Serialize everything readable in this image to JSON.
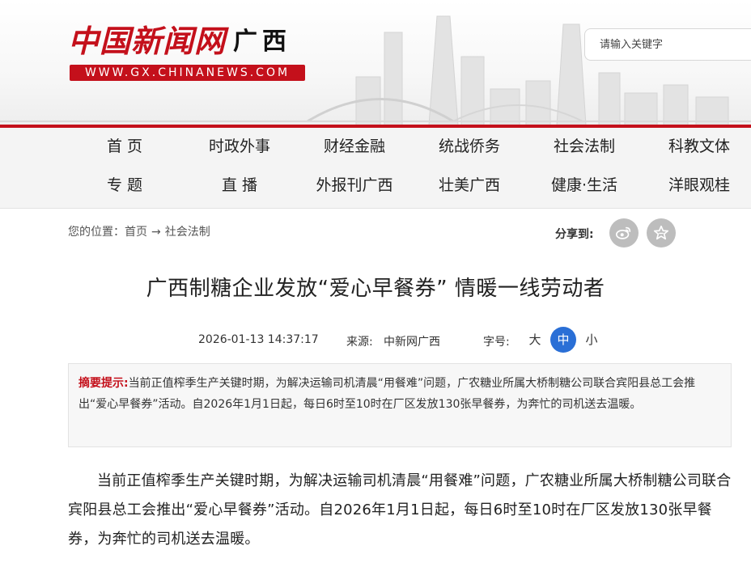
{
  "header": {
    "logo_cn": "中国新闻网",
    "logo_region": "广西",
    "logo_url": "WWW.GX.CHINANEWS.COM",
    "search_placeholder": "请输入关键字"
  },
  "nav": {
    "row1": [
      "首 页",
      "时政外事",
      "财经金融",
      "统战侨务",
      "社会法制",
      "科教文体"
    ],
    "row2": [
      "专 题",
      "直 播",
      "外报刊广西",
      "壮美广西",
      "健康·生活",
      "洋眼观桂"
    ]
  },
  "breadcrumb": {
    "prefix": "您的位置：",
    "home": "首页",
    "arrow": "→",
    "section": "社会法制"
  },
  "share": {
    "label": "分享到:",
    "icons": [
      "weibo-icon",
      "star-favorite-icon"
    ]
  },
  "article": {
    "title": "广西制糖企业发放“爱心早餐券” 情暖一线劳动者",
    "datetime": "2026-01-13 14:37:17",
    "source_label": "来源:",
    "source": "中新网广西",
    "font_size_label": "字号:",
    "font_sizes": [
      "大",
      "中",
      "小"
    ],
    "font_size_selected": "中",
    "summary_label": "摘要提示:",
    "summary_text": "当前正值榨季生产关键时期，为解决运输司机清晨“用餐难”问题，广农糖业所属大桥制糖公司联合宾阳县总工会推出“爱心早餐券”活动。自2026年1月1日起，每日6时至10时在厂区发放130张早餐券，为奔忙的司机送去温暖。",
    "paragraph_1": "当前正值榨季生产关键时期，为解决运输司机清晨“用餐难”问题，广农糖业所属大桥制糖公司联合宾阳县总工会推出“爱心早餐券”活动。自2026年1月1日起，每日6时至10时在厂区发放130张早餐券，为奔忙的司机送去温暖。"
  },
  "colors": {
    "brand_red": "#c4101b",
    "active_blue": "#2a6fd6",
    "share_gray": "#bdbdbd"
  }
}
